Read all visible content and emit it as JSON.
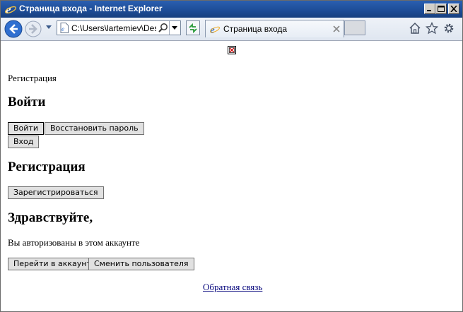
{
  "window": {
    "title": "Страница входа - Internet Explorer"
  },
  "toolbar": {
    "address": "C:\\Users\\lartemiev\\Desk",
    "tab_label": "Страница входа"
  },
  "page": {
    "register_link": "Регистрация",
    "login": {
      "heading": "Войти",
      "login_button": "Войти",
      "restore_button": "Восстановить пароль",
      "enter_button": "Вход"
    },
    "registration": {
      "heading": "Регистрация",
      "register_button": "Зарегистрироваться"
    },
    "welcome": {
      "heading": "Здравствуйте,",
      "message": "Вы авторизованы в этом аккаунте",
      "account_button": "Перейти в аккаунт",
      "switch_button": "Сменить пользователя"
    },
    "feedback_link": "Обратная связь"
  },
  "colors": {
    "titlebar": "#1d4c96",
    "link": "#00007a"
  }
}
